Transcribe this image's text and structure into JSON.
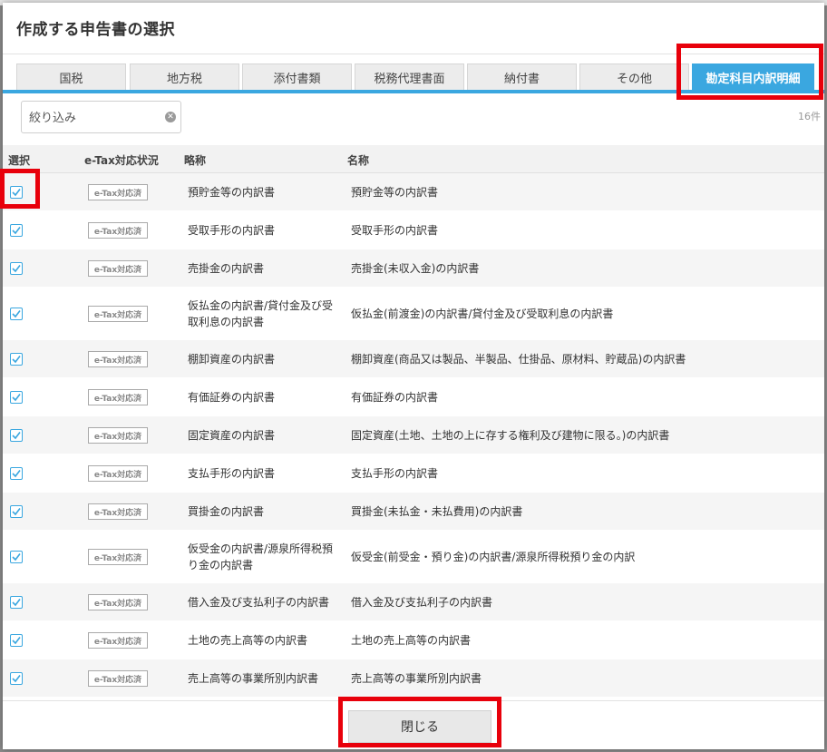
{
  "modal": {
    "title": "作成する申告書の選択"
  },
  "tabs": [
    {
      "label": "国税",
      "active": false
    },
    {
      "label": "地方税",
      "active": false
    },
    {
      "label": "添付書類",
      "active": false
    },
    {
      "label": "税務代理書面",
      "active": false
    },
    {
      "label": "納付書",
      "active": false
    },
    {
      "label": "その他",
      "active": false
    },
    {
      "label": "勘定科目内訳明細",
      "active": true
    }
  ],
  "filter": {
    "placeholder": "絞り込み",
    "value": ""
  },
  "count": "16件",
  "table": {
    "headers": {
      "select": "選択",
      "etax": "e-Tax対応状況",
      "abbr": "略称",
      "name": "名称"
    },
    "rows": [
      {
        "checked": true,
        "etax": "e-Tax対応済",
        "abbr": "預貯金等の内訳書",
        "name": "預貯金等の内訳書"
      },
      {
        "checked": true,
        "etax": "e-Tax対応済",
        "abbr": "受取手形の内訳書",
        "name": "受取手形の内訳書"
      },
      {
        "checked": true,
        "etax": "e-Tax対応済",
        "abbr": "売掛金の内訳書",
        "name": "売掛金(未収入金)の内訳書"
      },
      {
        "checked": true,
        "etax": "e-Tax対応済",
        "abbr": "仮払金の内訳書/貸付金及び受取利息の内訳書",
        "name": "仮払金(前渡金)の内訳書/貸付金及び受取利息の内訳書"
      },
      {
        "checked": true,
        "etax": "e-Tax対応済",
        "abbr": "棚卸資産の内訳書",
        "name": "棚卸資産(商品又は製品、半製品、仕掛品、原材料、貯蔵品)の内訳書"
      },
      {
        "checked": true,
        "etax": "e-Tax対応済",
        "abbr": "有価証券の内訳書",
        "name": "有価証券の内訳書"
      },
      {
        "checked": true,
        "etax": "e-Tax対応済",
        "abbr": "固定資産の内訳書",
        "name": "固定資産(土地、土地の上に存する権利及び建物に限る。)の内訳書"
      },
      {
        "checked": true,
        "etax": "e-Tax対応済",
        "abbr": "支払手形の内訳書",
        "name": "支払手形の内訳書"
      },
      {
        "checked": true,
        "etax": "e-Tax対応済",
        "abbr": "買掛金の内訳書",
        "name": "買掛金(未払金・未払費用)の内訳書"
      },
      {
        "checked": true,
        "etax": "e-Tax対応済",
        "abbr": "仮受金の内訳書/源泉所得税預り金の内訳書",
        "name": "仮受金(前受金・預り金)の内訳書/源泉所得税預り金の内訳"
      },
      {
        "checked": true,
        "etax": "e-Tax対応済",
        "abbr": "借入金及び支払利子の内訳書",
        "name": "借入金及び支払利子の内訳書"
      },
      {
        "checked": true,
        "etax": "e-Tax対応済",
        "abbr": "土地の売上高等の内訳書",
        "name": "土地の売上高等の内訳書"
      },
      {
        "checked": true,
        "etax": "e-Tax対応済",
        "abbr": "売上高等の事業所別内訳書",
        "name": "売上高等の事業所別内訳書"
      }
    ]
  },
  "footer": {
    "close_label": "閉じる"
  },
  "colors": {
    "accent": "#3aa7e0",
    "highlight": "#e8000b"
  }
}
